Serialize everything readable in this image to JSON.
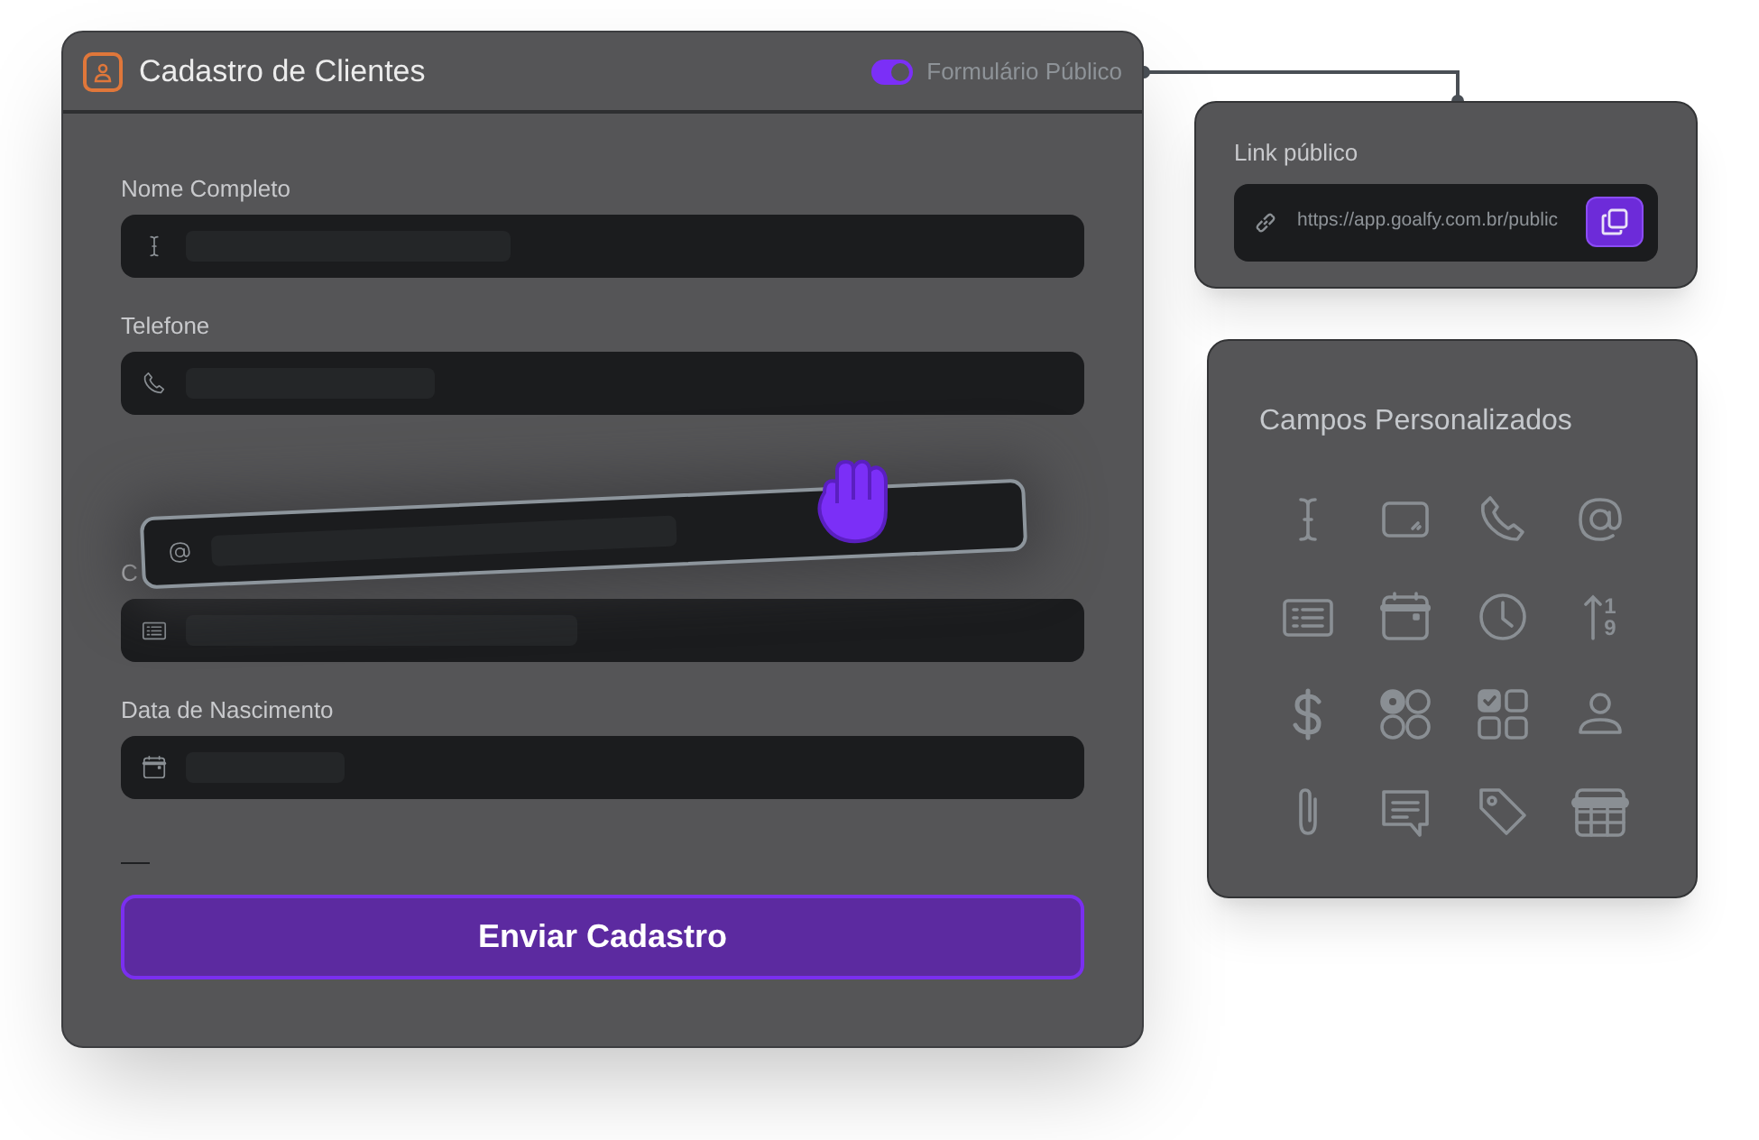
{
  "form": {
    "title": "Cadastro de Clientes",
    "public_toggle": {
      "label": "Formulário Público",
      "on": true
    },
    "fields": [
      {
        "label": "Nome Completo",
        "kind": "text"
      },
      {
        "label": "Telefone",
        "kind": "phone"
      },
      {
        "label": "C",
        "kind": "list"
      },
      {
        "label": "Data de Nascimento",
        "kind": "date"
      }
    ],
    "dragged_field": {
      "kind": "email"
    },
    "submit": "Enviar Cadastro"
  },
  "public_link": {
    "label": "Link público",
    "url": "https://app.goalfy.com.br/public"
  },
  "custom_fields": {
    "title": "Campos Personalizados",
    "items": [
      {
        "kind": "text"
      },
      {
        "kind": "textarea"
      },
      {
        "kind": "phone"
      },
      {
        "kind": "email"
      },
      {
        "kind": "list"
      },
      {
        "kind": "date"
      },
      {
        "kind": "time"
      },
      {
        "kind": "number",
        "digits": [
          "1",
          "9"
        ]
      },
      {
        "kind": "currency"
      },
      {
        "kind": "radio"
      },
      {
        "kind": "checkbox"
      },
      {
        "kind": "user"
      },
      {
        "kind": "attachment"
      },
      {
        "kind": "comment"
      },
      {
        "kind": "tag"
      },
      {
        "kind": "table"
      }
    ]
  }
}
